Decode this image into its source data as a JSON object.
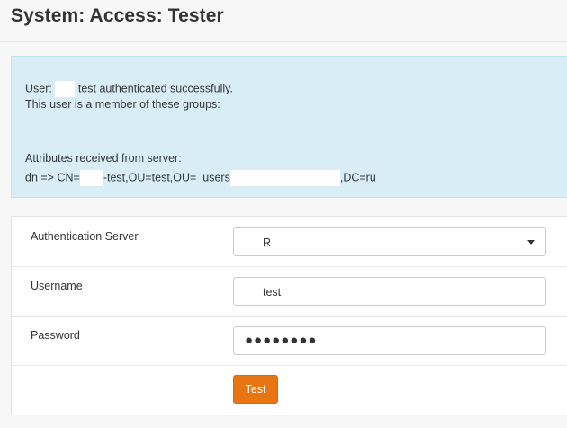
{
  "page": {
    "title": "System: Access: Tester"
  },
  "alert": {
    "line1_prefix": "User:",
    "line1_suffix": "test authenticated successfully.",
    "line2": "This user is a member of these groups:",
    "line3": "Attributes received from server:",
    "line4_a": "dn => CN=",
    "line4_b": "-test,OU=test,OU=_users",
    "line4_c": ",DC=ru"
  },
  "form": {
    "auth_server": {
      "label": "Authentication Server",
      "value": "R"
    },
    "username": {
      "label": "Username",
      "value": "test"
    },
    "password": {
      "label": "Password",
      "masked": "●●●●●●●●"
    },
    "test_button": {
      "label": "Test"
    }
  },
  "colors": {
    "accent": "#e97512",
    "alert_bg": "#d9edf7"
  }
}
